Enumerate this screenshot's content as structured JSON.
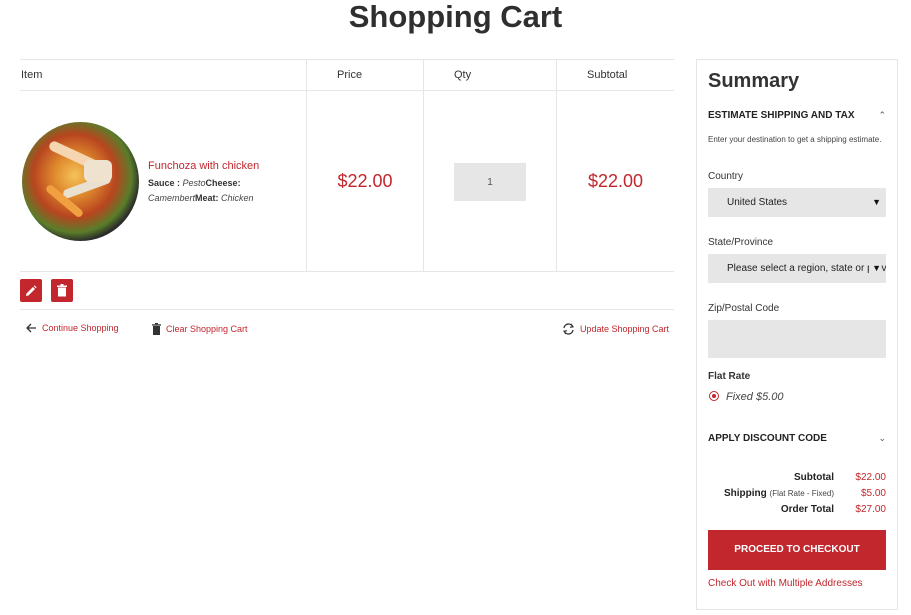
{
  "page": {
    "title": "Shopping Cart"
  },
  "table": {
    "headers": {
      "item": "Item",
      "price": "Price",
      "qty": "Qty",
      "subtotal": "Subtotal"
    },
    "row": {
      "name": "Funchoza with chicken",
      "options": [
        {
          "label": "Sauce :",
          "value": "Pesto"
        },
        {
          "label": "Cheese:",
          "value": "Camembert"
        },
        {
          "label": "Meat:",
          "value": "Chicken"
        }
      ],
      "price": "$22.00",
      "qty": "1",
      "subtotal": "$22.00"
    }
  },
  "links": {
    "continue": "Continue Shopping",
    "clear": "Clear Shopping Cart",
    "update": "Update Shopping Cart"
  },
  "summary": {
    "title": "Summary",
    "shipping_head": "ESTIMATE SHIPPING AND TAX",
    "hint": "Enter your destination to get a shipping estimate.",
    "country_label": "Country",
    "country_value": "United States",
    "state_label": "State/Province",
    "state_value": "Please select a region, state or province.",
    "zip_label": "Zip/Postal Code",
    "flat_rate_label": "Flat Rate",
    "flat_rate_option": "Fixed $5.00",
    "discount_head": "APPLY DISCOUNT CODE",
    "subtotal_label": "Subtotal",
    "subtotal_value": "$22.00",
    "shipping_label": "Shipping",
    "shipping_note": "(Flat Rate - Fixed)",
    "shipping_value": "$5.00",
    "total_label": "Order Total",
    "total_value": "$27.00",
    "checkout_label": "PROCEED TO CHECKOUT",
    "multi_label": "Check Out with Multiple Addresses"
  },
  "icons": {
    "edit": "pencil-icon",
    "delete": "trash-icon",
    "back": "arrow-left-icon",
    "clear": "trash-icon",
    "update": "refresh-icon",
    "up": "chevron-up-icon",
    "down": "chevron-down-icon"
  },
  "colors": {
    "accent": "#c1272d",
    "field_bg": "#e6e6e6"
  }
}
